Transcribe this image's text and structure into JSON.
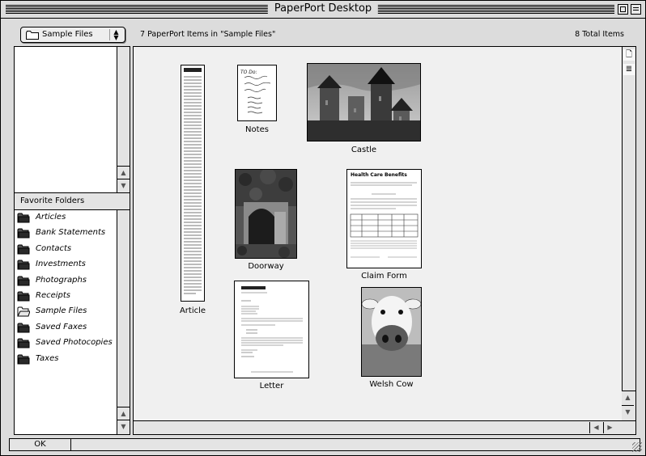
{
  "window": {
    "title": "PaperPort Desktop"
  },
  "toolbar": {
    "folder_selected": "Sample Files",
    "items_count_text": "7 PaperPort Items in \"Sample Files\"",
    "total_items_text": "8 Total Items"
  },
  "sidebar": {
    "favorites_header": "Favorite Folders",
    "folders": [
      {
        "label": "Articles",
        "icon": "folder-icon"
      },
      {
        "label": "Bank Statements",
        "icon": "folder-icon"
      },
      {
        "label": "Contacts",
        "icon": "folder-icon"
      },
      {
        "label": "Investments",
        "icon": "folder-icon"
      },
      {
        "label": "Photographs",
        "icon": "folder-icon"
      },
      {
        "label": "Receipts",
        "icon": "folder-icon"
      },
      {
        "label": "Sample Files",
        "icon": "folder-open-icon"
      },
      {
        "label": "Saved Faxes",
        "icon": "folder-icon"
      },
      {
        "label": "Saved Photocopies",
        "icon": "folder-icon"
      },
      {
        "label": "Taxes",
        "icon": "folder-icon"
      }
    ]
  },
  "desktop": {
    "items": [
      {
        "label": "Article",
        "kind": "text-document"
      },
      {
        "label": "Notes",
        "kind": "handwritten-note"
      },
      {
        "label": "Castle",
        "kind": "photo"
      },
      {
        "label": "Doorway",
        "kind": "photo"
      },
      {
        "label": "Claim Form",
        "kind": "form-document"
      },
      {
        "label": "Letter",
        "kind": "letter-document"
      },
      {
        "label": "Welsh Cow",
        "kind": "photo"
      }
    ],
    "claim_form_heading": "Health Care Benefits",
    "note_text_line": "TO Do:"
  },
  "statusbar": {
    "status_text": "OK"
  },
  "colors": {
    "window_bg": "#dcdcdc",
    "desktop_bg": "#f0f0f0",
    "border": "#000000"
  }
}
